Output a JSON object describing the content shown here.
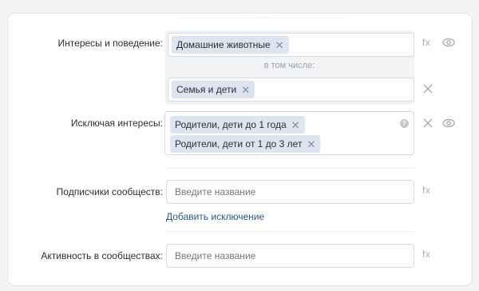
{
  "rows": {
    "interests": {
      "label": "Интересы и поведение:",
      "tag1": "Домашние животные",
      "also_label": "в том числе:",
      "tag2": "Семья и дети"
    },
    "exclude_interests": {
      "label": "Исключая интересы:",
      "tag1": "Родители, дети до 1 года",
      "tag2": "Родители, дети от 1 до 3 лет"
    },
    "subscribers": {
      "label": "Подписчики сообществ:",
      "placeholder": "Введите название",
      "add_exclusion": "Добавить исключение"
    },
    "activity": {
      "label": "Активность в сообществах:",
      "placeholder": "Введите название"
    }
  },
  "icons": {
    "fx_label": "fx",
    "info_glyph": "?"
  },
  "colors": {
    "tag_bg": "#dde6f0",
    "link": "#2a5885",
    "icon_gray": "#a5adb7"
  }
}
